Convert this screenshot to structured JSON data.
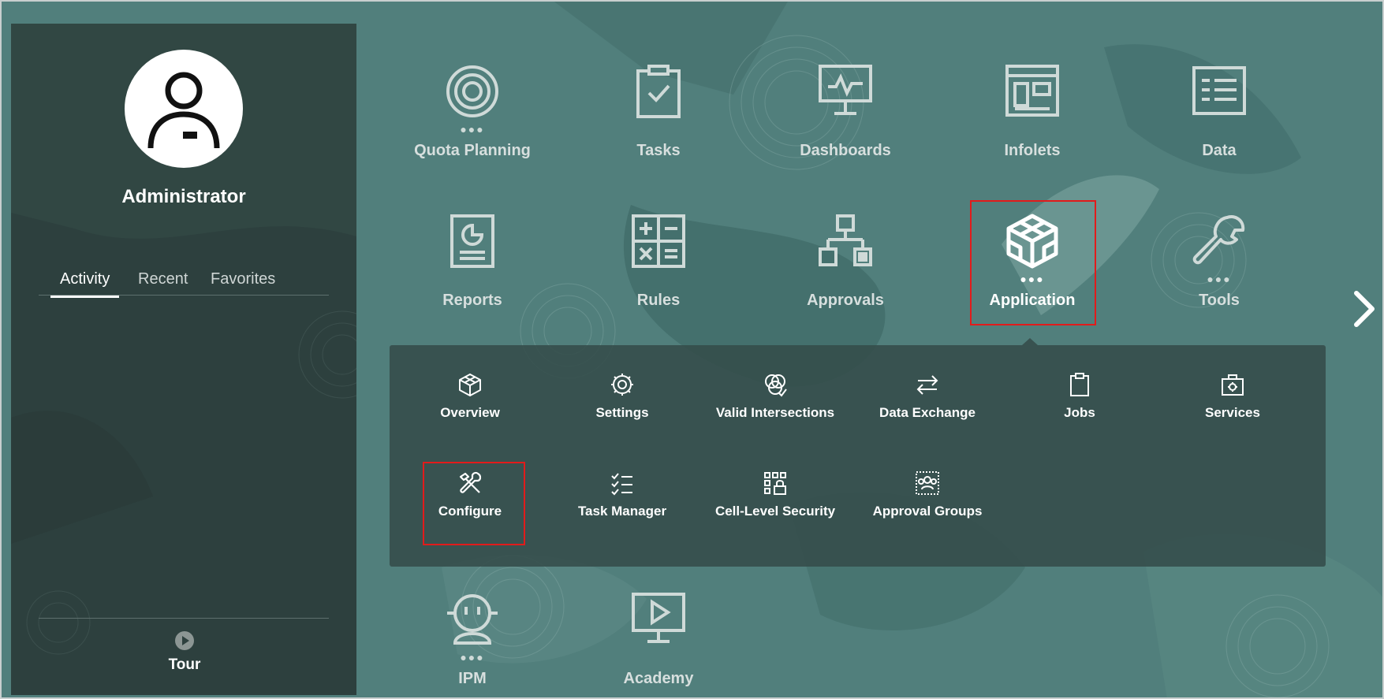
{
  "user": {
    "name": "Administrator"
  },
  "sidebar_tabs": [
    {
      "label": "Activity",
      "active": true
    },
    {
      "label": "Recent",
      "active": false
    },
    {
      "label": "Favorites",
      "active": false
    }
  ],
  "tour": {
    "label": "Tour"
  },
  "tiles": [
    {
      "label": "Quota Planning",
      "icon": "target-icon",
      "dots": true
    },
    {
      "label": "Tasks",
      "icon": "clipboard-check-icon",
      "dots": false
    },
    {
      "label": "Dashboards",
      "icon": "monitor-pulse-icon",
      "dots": false
    },
    {
      "label": "Infolets",
      "icon": "infolet-icon",
      "dots": false
    },
    {
      "label": "Data",
      "icon": "data-grid-icon",
      "dots": false
    },
    {
      "label": "Reports",
      "icon": "report-icon",
      "dots": false
    },
    {
      "label": "Rules",
      "icon": "calculator-icon",
      "dots": false
    },
    {
      "label": "Approvals",
      "icon": "hierarchy-icon",
      "dots": false
    },
    {
      "label": "Application",
      "icon": "cube-icon",
      "dots": true,
      "selected": true
    },
    {
      "label": "Tools",
      "icon": "wrench-icon",
      "dots": true
    },
    {
      "label": "IPM",
      "icon": "robot-icon",
      "dots": true
    },
    {
      "label": "Academy",
      "icon": "play-monitor-icon",
      "dots": false
    }
  ],
  "dots_glyph": "●●●",
  "application_menu": [
    {
      "label": "Overview",
      "icon": "cube-icon"
    },
    {
      "label": "Settings",
      "icon": "gear-icon"
    },
    {
      "label": "Valid Intersections",
      "icon": "intersect-icon"
    },
    {
      "label": "Data Exchange",
      "icon": "exchange-arrows-icon"
    },
    {
      "label": "Jobs",
      "icon": "clipboard-icon"
    },
    {
      "label": "Services",
      "icon": "toolbox-icon"
    },
    {
      "label": "Configure",
      "icon": "tools-icon",
      "highlighted": true
    },
    {
      "label": "Task Manager",
      "icon": "checklist-icon"
    },
    {
      "label": "Cell-Level Security",
      "icon": "cell-security-icon"
    },
    {
      "label": "Approval Groups",
      "icon": "group-icon"
    }
  ],
  "colors": {
    "background": "#4f7f7b",
    "sidebar": "#2d403e",
    "highlight": "#e21b1b",
    "icon": "#cfdad8"
  }
}
